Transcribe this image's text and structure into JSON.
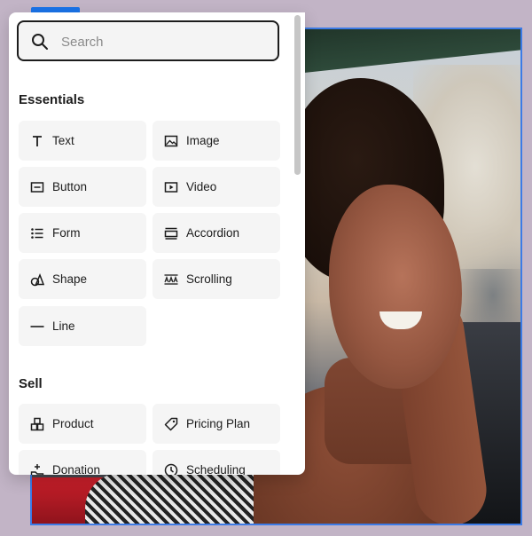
{
  "search": {
    "placeholder": "Search"
  },
  "sections": {
    "essentials": {
      "title": "Essentials",
      "items": [
        {
          "label": "Text",
          "icon": "text-icon"
        },
        {
          "label": "Image",
          "icon": "image-icon"
        },
        {
          "label": "Button",
          "icon": "button-icon"
        },
        {
          "label": "Video",
          "icon": "video-icon"
        },
        {
          "label": "Form",
          "icon": "form-icon"
        },
        {
          "label": "Accordion",
          "icon": "accordion-icon"
        },
        {
          "label": "Shape",
          "icon": "shape-icon"
        },
        {
          "label": "Scrolling",
          "icon": "scrolling-icon"
        },
        {
          "label": "Line",
          "icon": "line-icon"
        }
      ]
    },
    "sell": {
      "title": "Sell",
      "items": [
        {
          "label": "Product",
          "icon": "product-icon"
        },
        {
          "label": "Pricing Plan",
          "icon": "pricing-tag-icon"
        },
        {
          "label": "Donation",
          "icon": "donation-icon"
        },
        {
          "label": "Scheduling",
          "icon": "clock-icon"
        }
      ]
    }
  },
  "colors": {
    "selection_border": "#3c7be6",
    "panel_bg": "#ffffff",
    "tile_bg": "#f5f5f5"
  }
}
